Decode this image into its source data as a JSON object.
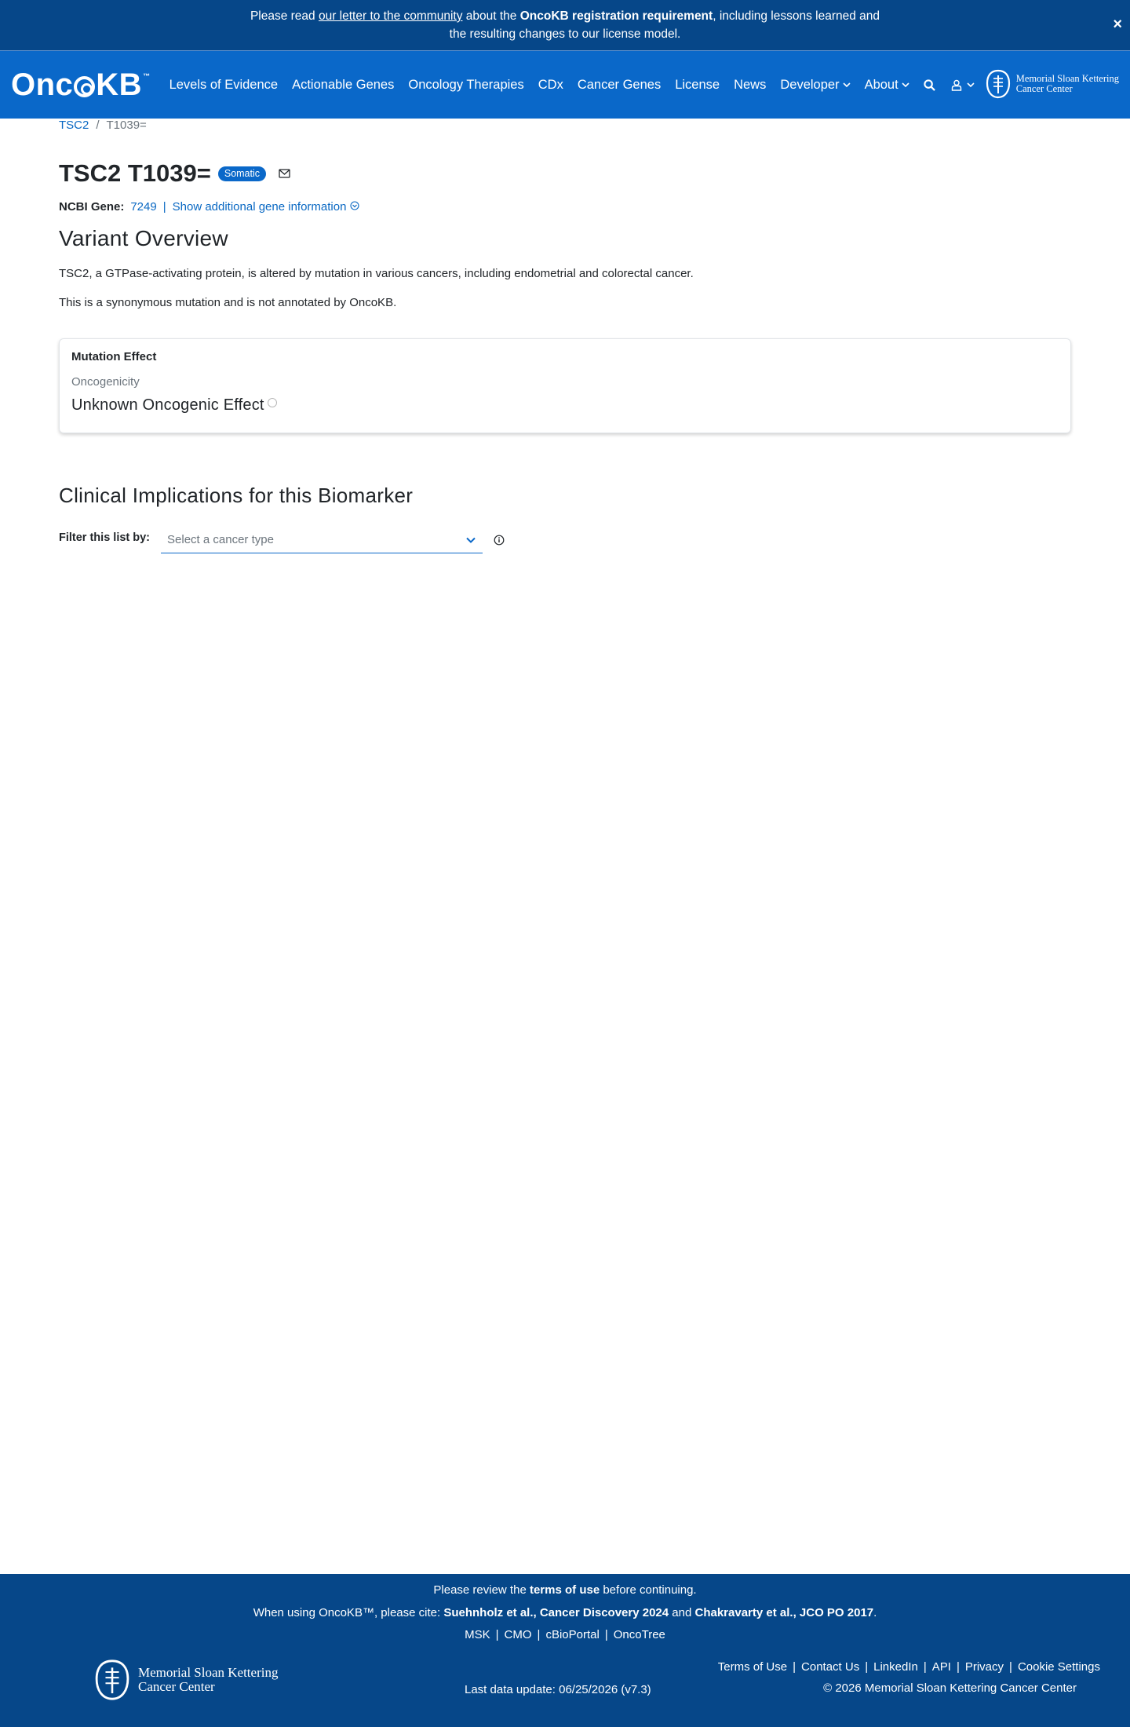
{
  "announcement": {
    "prefix": "Please read ",
    "link": "our letter to the community",
    "middle": " about the ",
    "bold": "OncoKB registration requirement",
    "suffix": ", including lessons learned and",
    "line2": "the resulting changes to our license model.",
    "close": "×"
  },
  "navbar": {
    "logo_left": "Onc",
    "logo_right": "KB",
    "logo_tm": "™",
    "items": [
      {
        "label": "Levels of Evidence"
      },
      {
        "label": "Actionable Genes"
      },
      {
        "label": "Oncology Therapies"
      },
      {
        "label": "CDx"
      },
      {
        "label": "Cancer Genes"
      },
      {
        "label": "License"
      },
      {
        "label": "News"
      },
      {
        "label": "Developer"
      },
      {
        "label": "About"
      }
    ],
    "msk_line1": "Memorial Sloan Kettering",
    "msk_line2": "Cancer Center"
  },
  "breadcrumb": {
    "gene": "TSC2",
    "sep": "/",
    "current": "T1039="
  },
  "title": {
    "text": "TSC2 T1039=",
    "badge": "Somatic"
  },
  "gene_info": {
    "label": "NCBI Gene:",
    "id": "7249",
    "pipe": "|",
    "link": "Show additional gene information"
  },
  "overview": {
    "heading": "Variant Overview",
    "description": "TSC2, a GTPase-activating protein, is altered by mutation in various cancers, including endometrial and colorectal cancer.",
    "note": "This is a synonymous mutation and is not annotated by OncoKB."
  },
  "mutation_card": {
    "title": "Mutation Effect",
    "subtitle": "Oncogenicity",
    "value": "Unknown Oncogenic Effect"
  },
  "clinical": {
    "heading": "Clinical Implications for this Biomarker",
    "filter_label": "Filter this list by:",
    "select_placeholder": "Select a cancer type"
  },
  "footer": {
    "review_prefix": "Please review the ",
    "review_bold": "terms of use",
    "review_suffix": " before continuing.",
    "cite_prefix": "When using OncoKB™, please cite: ",
    "cite_bold1": "Suehnholz et al., Cancer Discovery 2024",
    "cite_and": " and ",
    "cite_bold2": "Chakravarty et al., JCO PO 2017",
    "cite_end": ".",
    "links": [
      "MSK",
      "CMO",
      "cBioPortal",
      "OncoTree"
    ],
    "right_links": [
      "Terms of Use",
      "Contact Us",
      "LinkedIn",
      "API",
      "Privacy",
      "Cookie Settings"
    ],
    "msk_line1": "Memorial Sloan Kettering",
    "msk_line2": "Cancer Center",
    "last_update": "Last data update: 06/25/2026 (v7.3)",
    "copyright": "© 2026 Memorial Sloan Kettering Cancer Center"
  },
  "colors": {
    "announcement_bg": "#064789",
    "navbar_bg": "#0a68c9",
    "link": "#0968c3",
    "footer_bg": "#064789"
  },
  "icons": [
    "close-icon",
    "chevron-down-icon",
    "search-icon",
    "user-icon",
    "msk-logo-icon",
    "mail-icon",
    "chevron-circle-down-icon",
    "info-icon"
  ]
}
